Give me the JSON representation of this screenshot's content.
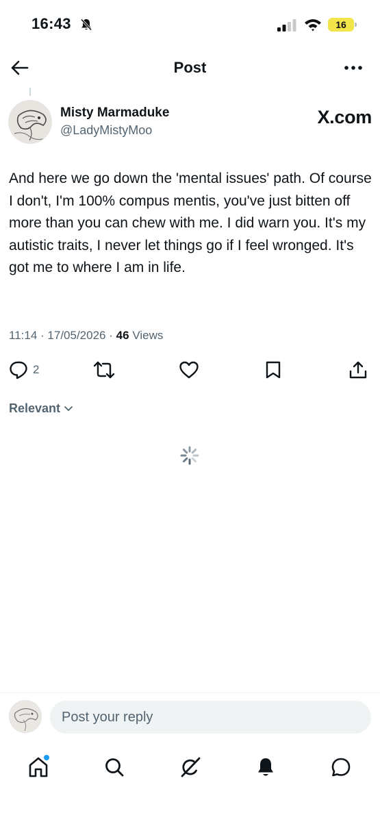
{
  "status_bar": {
    "time": "16:43",
    "battery": "16",
    "icons": [
      "bell-muted-icon",
      "signal-icon",
      "wifi-icon",
      "battery-icon"
    ]
  },
  "header": {
    "title": "Post",
    "back_icon": "arrow-left-icon",
    "more_icon": "more-horizontal-icon"
  },
  "post": {
    "author_name": "Misty Marmaduke",
    "author_handle": "@LadyMistyMoo",
    "site_badge": "X.com",
    "text": "And here we go down the 'mental issues' path. Of course I don't, I'm 100% compus mentis, you've just bitten off more than you can chew with me. I did warn you. It's my autistic traits, I never let things go if I feel wronged. It's got me to where I am in life.",
    "time": "11:14",
    "date": "17/05/2026",
    "separator": "·",
    "views_count": "46",
    "views_label": "Views"
  },
  "actions": {
    "reply_count": "2",
    "icons": [
      "reply-icon",
      "repost-icon",
      "like-icon",
      "bookmark-icon",
      "share-icon"
    ]
  },
  "replies": {
    "filter_label": "Relevant",
    "loading": true
  },
  "reply_bar": {
    "placeholder": "Post your reply"
  },
  "tab_bar": {
    "items": [
      "home-icon",
      "search-icon",
      "grok-icon",
      "notifications-icon",
      "messages-icon"
    ],
    "home_has_notification": true
  },
  "colors": {
    "text": "#0f1419",
    "secondary": "#536471",
    "accent": "#1d9bf0",
    "battery": "#f2e44a"
  }
}
